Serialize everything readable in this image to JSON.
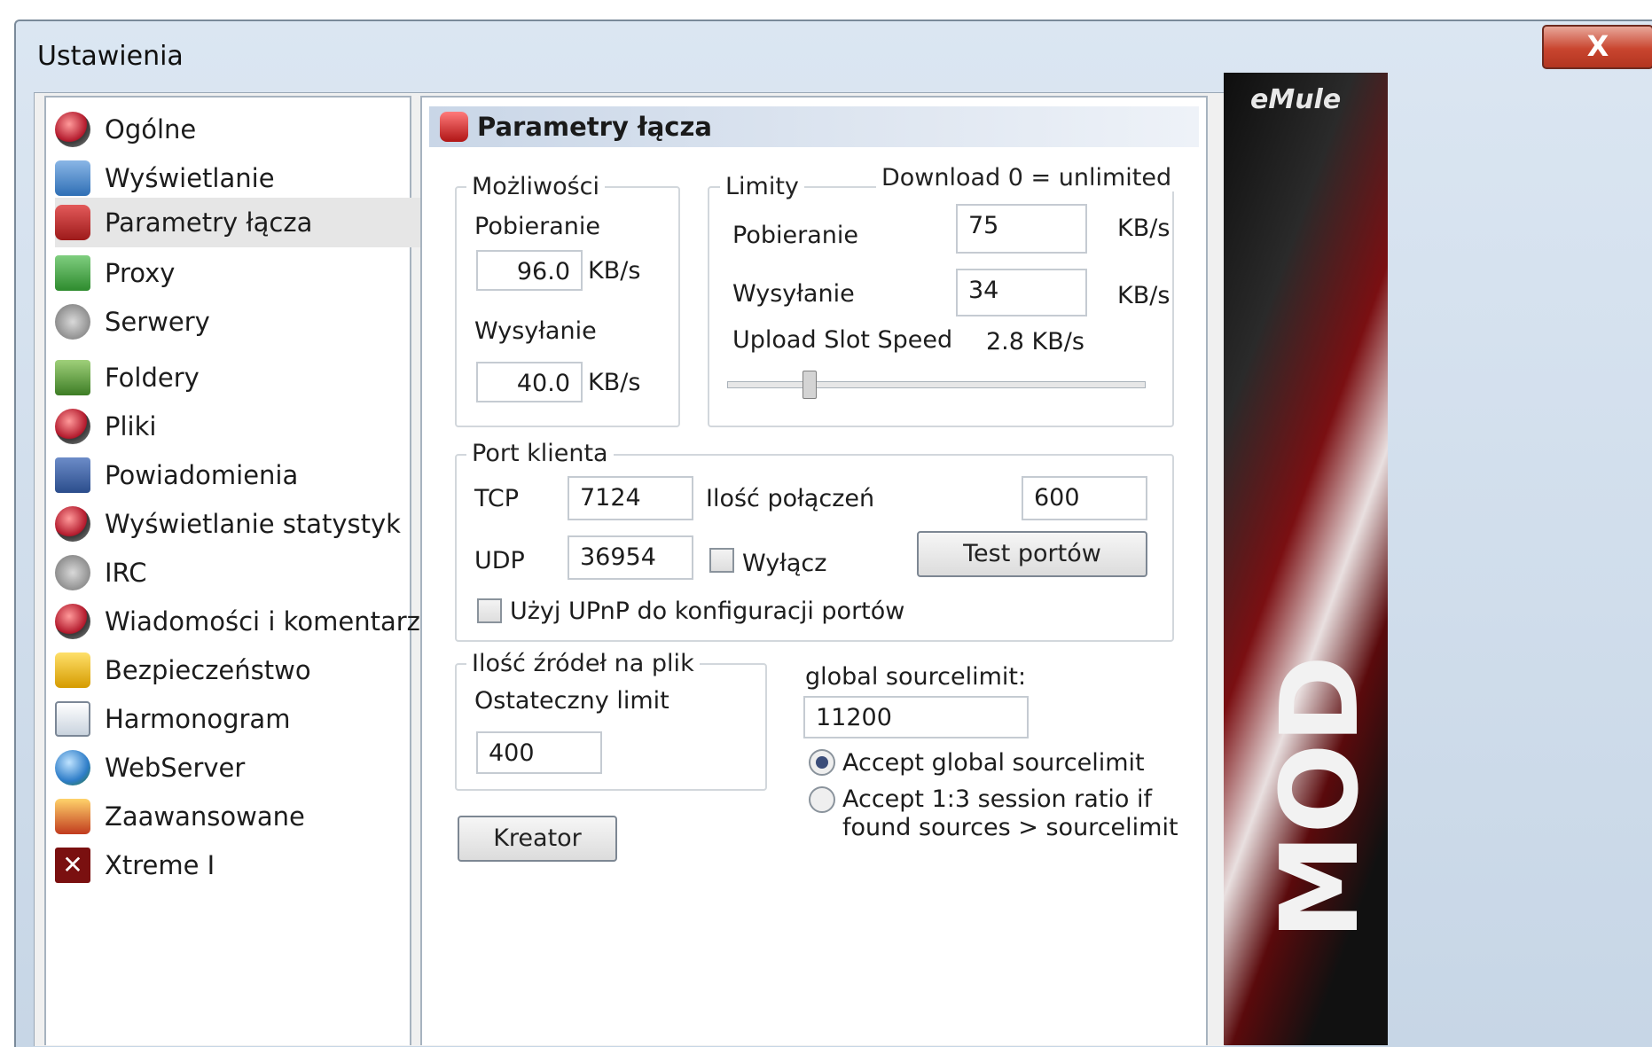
{
  "window": {
    "title": "Ustawienia",
    "close_label": "X"
  },
  "sidebar": {
    "items": [
      {
        "label": "Ogólne",
        "icon": "general-icon"
      },
      {
        "label": "Wyświetlanie",
        "icon": "display-icon"
      },
      {
        "label": "Parametry łącza",
        "icon": "connection-icon",
        "selected": true
      },
      {
        "label": "Proxy",
        "icon": "proxy-icon"
      },
      {
        "label": "Serwery",
        "icon": "servers-icon"
      },
      {
        "label": "Foldery",
        "icon": "folders-icon"
      },
      {
        "label": "Pliki",
        "icon": "files-icon"
      },
      {
        "label": "Powiadomienia",
        "icon": "notifications-icon"
      },
      {
        "label": "Wyświetlanie statystyk",
        "icon": "statistics-icon"
      },
      {
        "label": "IRC",
        "icon": "irc-icon"
      },
      {
        "label": "Wiadomości i komentarze",
        "icon": "messages-icon"
      },
      {
        "label": "Bezpieczeństwo",
        "icon": "lock-icon"
      },
      {
        "label": "Harmonogram",
        "icon": "calendar-icon"
      },
      {
        "label": "WebServer",
        "icon": "globe-icon"
      },
      {
        "label": "Zaawansowane",
        "icon": "advanced-icon"
      },
      {
        "label": "Xtreme I",
        "icon": "xtreme-icon"
      }
    ]
  },
  "main": {
    "header_title": "Parametry łącza",
    "capacities": {
      "title": "Możliwości",
      "download_label": "Pobieranie",
      "download_value": "96.0",
      "upload_label": "Wysyłanie",
      "upload_value": "40.0",
      "unit": "KB/s"
    },
    "limits": {
      "title": "Limity",
      "note": "Download 0 = unlimited",
      "download_label": "Pobieranie",
      "download_value": "75",
      "upload_label": "Wysyłanie",
      "upload_value": "34",
      "unit": "KB/s",
      "slot_label": "Upload Slot Speed",
      "slot_value": "2.8 KB/s"
    },
    "client_port": {
      "title": "Port klienta",
      "tcp_label": "TCP",
      "tcp_value": "7124",
      "udp_label": "UDP",
      "udp_value": "36954",
      "connections_label": "Ilość połączeń",
      "connections_value": "600",
      "disable_label": "Wyłącz",
      "test_button": "Test portów",
      "upnp_label": "Użyj UPnP do konfiguracji portów"
    },
    "sources": {
      "title": "Ilość źródeł na plik",
      "hard_limit_label": "Ostateczny limit",
      "hard_limit_value": "400",
      "global_label": "global sourcelimit:",
      "global_value": "11200",
      "radio_accept_global": "Accept global sourcelimit",
      "radio_accept_ratio_line1": "Accept 1:3 session ratio if",
      "radio_accept_ratio_line2": "found sources > sourcelimit"
    },
    "wizard_button": "Kreator"
  },
  "banner": {
    "logo_text": "eMule",
    "side_text": "MOD"
  }
}
